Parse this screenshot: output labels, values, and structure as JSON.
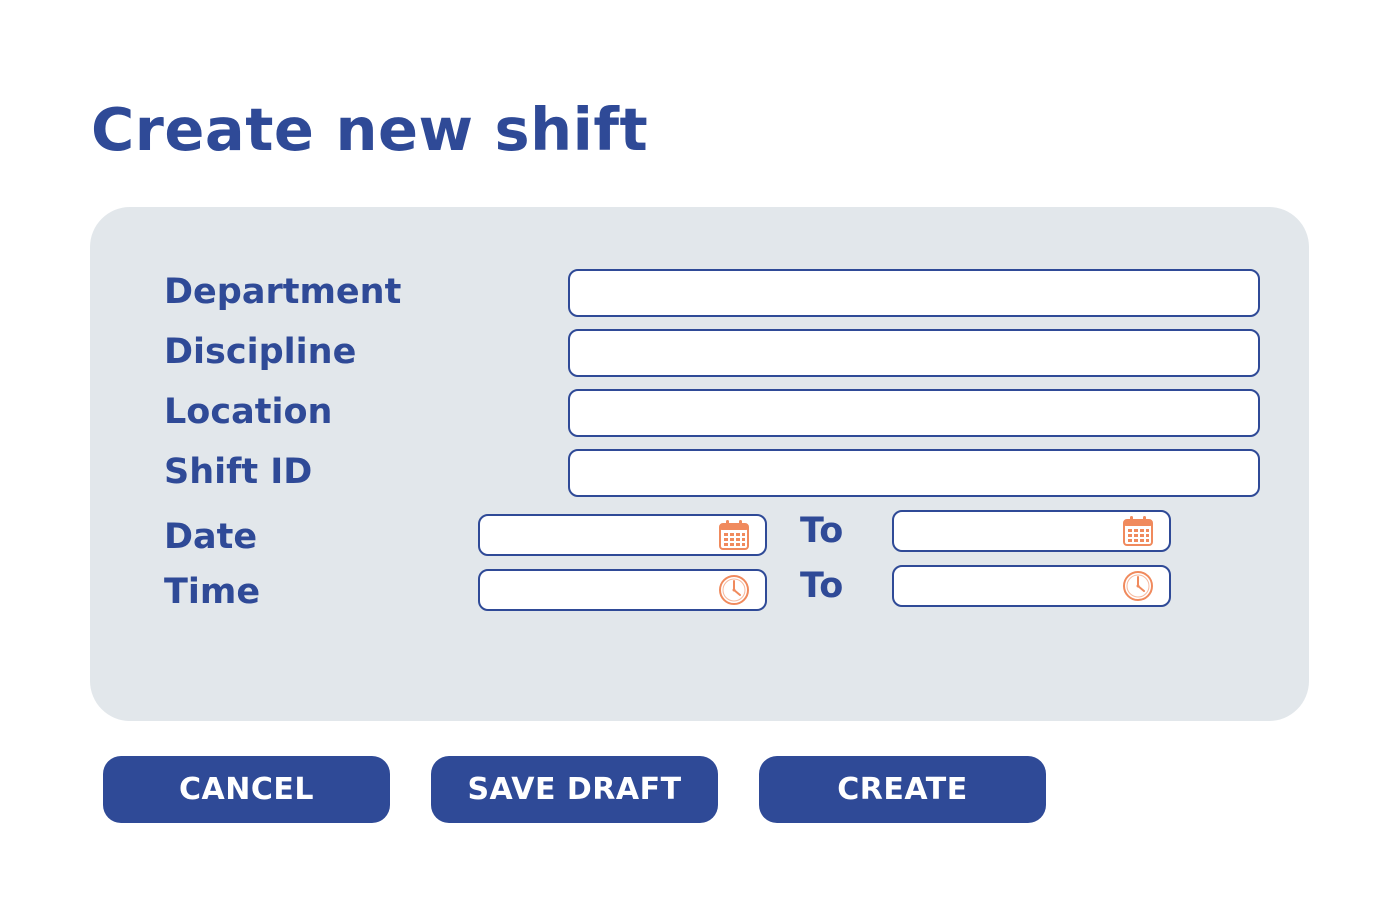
{
  "page": {
    "title": "Create new shift"
  },
  "form": {
    "department": {
      "label": "Department",
      "value": ""
    },
    "discipline": {
      "label": "Discipline",
      "value": ""
    },
    "location": {
      "label": "Location",
      "value": ""
    },
    "shift_id": {
      "label": "Shift ID",
      "value": ""
    },
    "date": {
      "label": "Date",
      "from_value": "",
      "to_label": "To",
      "to_value": "",
      "icon": "calendar-icon"
    },
    "time": {
      "label": "Time",
      "from_value": "",
      "to_label": "To",
      "to_value": "",
      "icon": "clock-icon"
    }
  },
  "actions": {
    "cancel_label": "CANCEL",
    "save_draft_label": "SAVE DRAFT",
    "create_label": "CREATE"
  },
  "colors": {
    "primary": "#2f4a97",
    "panel_background": "#e2e7eb",
    "icon_accent": "#f08a5d",
    "page_background": "#ffffff",
    "button_text": "#ffffff"
  }
}
